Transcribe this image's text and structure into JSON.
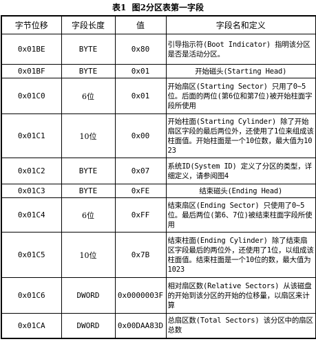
{
  "table_caption": "表1  图2分区表第一字段",
  "columns": [
    "字节位移",
    "字段长度",
    "值",
    "字段名和定义"
  ],
  "rows": [
    {
      "offset": "0x01BE",
      "length": "BYTE",
      "value": "0x80",
      "desc": "引导指示符(Boot Indicator) 指明该分区是否是活动分区。"
    },
    {
      "offset": "0x01BF",
      "length": "BYTE",
      "value": "0x01",
      "desc": "开始磁头(Starting Head)"
    },
    {
      "offset": "0x01C0",
      "length": "6位",
      "value": "0x01",
      "desc": "开始扇区(Starting Sector) 只用了0~5位。后面的两位(第6位和第7位)被开始柱面字段所使用"
    },
    {
      "offset": "0x01C1",
      "length": "10位",
      "value": "0x00",
      "desc": "开始柱面(Starting Cylinder) 除了开始扇区字段的最后两位外，还使用了1位来组成该柱面值。开始柱面是一个10位数，最大值为1023"
    },
    {
      "offset": "0x01C2",
      "length": "BYTE",
      "value": "0x07",
      "desc": "系统ID(System ID) 定义了分区的类型，详细定义，请参阅图4"
    },
    {
      "offset": "0x01C3",
      "length": "BYTE",
      "value": "0xFE",
      "desc": "结束磁头(Ending Head)"
    },
    {
      "offset": "0x01C4",
      "length": "6位",
      "value": "0xFF",
      "desc": "结束扇区(Ending Sector) 只使用了0~5位。最后两位(第6、7位)被结束柱面字段所使用"
    },
    {
      "offset": "0x01C5",
      "length": "10位",
      "value": "0x7B",
      "desc": "结束柱面(Ending Cylinder) 除了结束扇区字段最后的两位外，还使用了1位，以组成该柱面值。结束柱面是一个10位的数，最大值为1023"
    },
    {
      "offset": "0x01C6",
      "length": "DWORD",
      "value": "0x0000003F",
      "desc": "相对扇区数(Relative Sectors) 从该磁盘的开始到该分区的开始的位移量，以扇区来计算"
    },
    {
      "offset": "0x01CA",
      "length": "DWORD",
      "value": "0x00DAA83D",
      "desc": "总扇区数(Total Sectors) 该分区中的扇区总数"
    }
  ]
}
